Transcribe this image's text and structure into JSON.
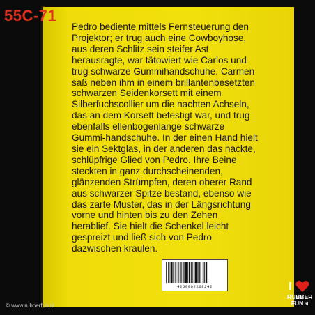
{
  "product_code": "55C-71",
  "book_text": [
    "Pedro bediente mittels Fernsteuerung den",
    "Projektor; er trug auch eine Cowboyhose,",
    "aus deren Schlitz sein steifer Ast",
    "herausragte, war tätowiert wie Carlos und",
    "trug schwarze Gummihandschuhe. Carmen",
    "saß neben ihm in einem brillantenbesetzten",
    "schwarzen Seidenkorsett mit einem",
    "Silberfuchscollier um die nachten Achseln,",
    "das an dem Korsett befestigt war, und trug",
    "ebenfalls ellenbogenlange schwarze",
    "Gummi-handschuhe. In der einen Hand hielt",
    "sie ein Sektglas,  in der anderen das nackte,",
    "schlüpfrige Glied von Pedro. Ihre Beine",
    "steckten in ganz durchscheinenden,",
    "glänzenden Strümpfen, deren oberer Rand",
    "aus schwarzer Spitze bestand, ebenso wie",
    "das zarte Muster, das in der Längsrichtung",
    "vorne und hinten bis zu den Zehen",
    "herablief. Sie hielt die Schenkel leicht",
    "gespreizt und ließ sich von Pedro",
    "dazwischen kraulen."
  ],
  "barcode_number": "4260002268242",
  "website": "© www.rubberfun.nl",
  "logo": {
    "letter": "I",
    "line1": "RUBBER",
    "line2": "FUN",
    "suffix": ".nl",
    "heart_color": "#e0201a"
  },
  "colors": {
    "code_red": "#e03020",
    "page_yellow": "#f2e00c",
    "background": "#0b0b0b"
  }
}
